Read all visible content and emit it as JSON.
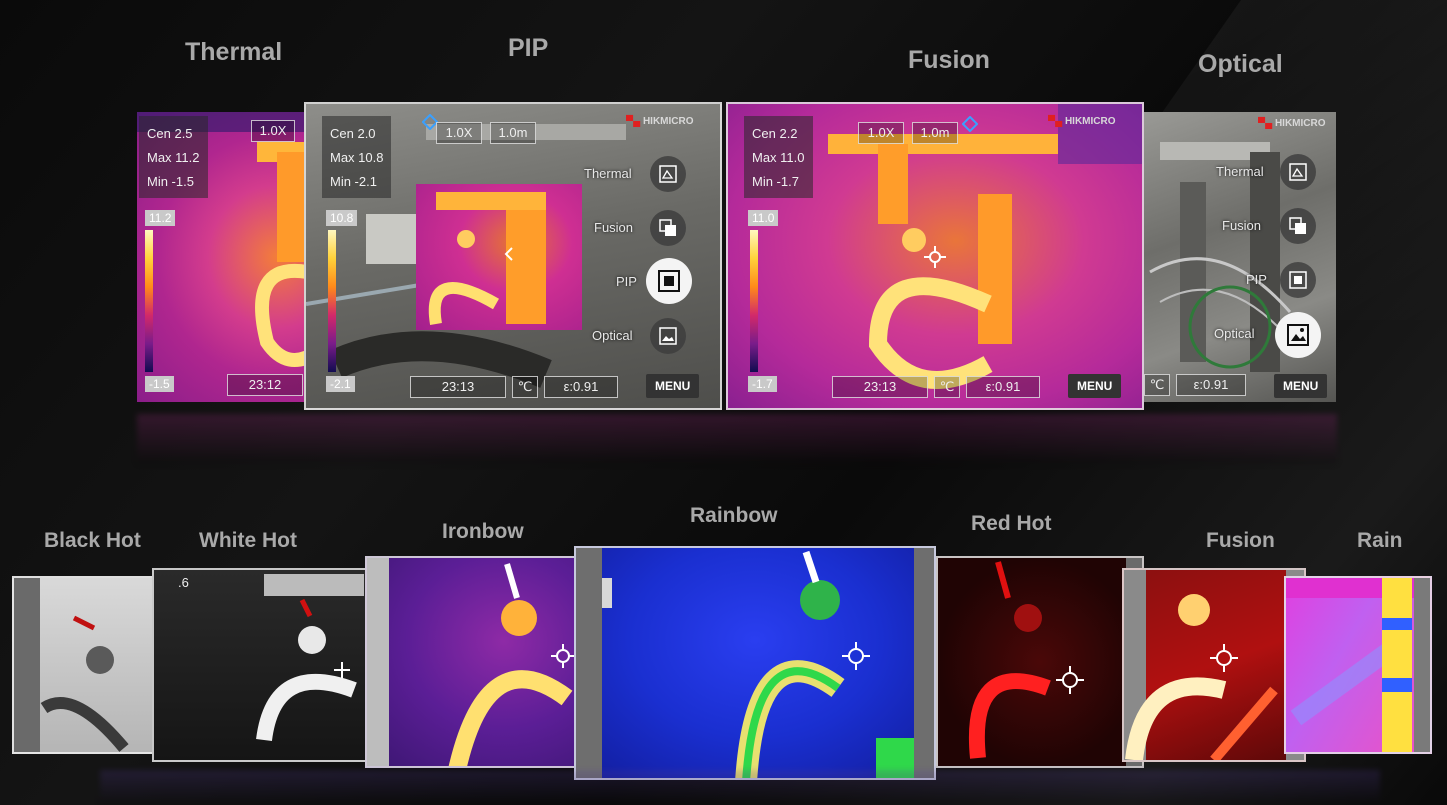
{
  "top_titles": {
    "thermal": "Thermal",
    "pip": "PIP",
    "fusion": "Fusion",
    "optical": "Optical"
  },
  "thermal": {
    "cen": "Cen 2.5",
    "max": "Max 11.2",
    "min": "Min -1.5",
    "zoom": "1.0X",
    "scale_max": "11.2",
    "scale_min": "-1.5",
    "time": "23:12"
  },
  "pip": {
    "cen": "Cen 2.0",
    "max": "Max 10.8",
    "min": "Min -2.1",
    "zoom": "1.0X",
    "distance": "1.0m",
    "scale_max": "10.8",
    "scale_min": "-2.1",
    "time": "23:13",
    "unit": "℃",
    "emissivity": "ε:0.91",
    "logo": "HIKMICRO",
    "menu": "MENU"
  },
  "fusion": {
    "cen": "Cen 2.2",
    "max": "Max 11.0",
    "min": "Min -1.7",
    "zoom": "1.0X",
    "distance": "1.0m",
    "scale_max": "11.0",
    "scale_min": "-1.7",
    "time": "23:13",
    "unit": "℃",
    "emissivity": "ε:0.91",
    "logo": "HIKMICRO",
    "menu": "MENU"
  },
  "optical": {
    "logo": "HIKMICRO",
    "unit": "℃",
    "emissivity": "ε:0.91",
    "menu": "MENU"
  },
  "mode_menu": {
    "thermal": "Thermal",
    "fusion": "Fusion",
    "pip": "PIP",
    "optical": "Optical"
  },
  "palette_titles": {
    "black_hot": "Black Hot",
    "white_hot": "White Hot",
    "ironbow": "Ironbow",
    "rainbow": "Rainbow",
    "red_hot": "Red Hot",
    "fusion": "Fusion",
    "rain": "Rain"
  },
  "white_hot_tag": ".6",
  "colors": {
    "magenta": "#c2208e",
    "orange": "#ff9f1a",
    "hot_yellow": "#ffe680",
    "rainbow_blue": "#1a2fd0",
    "red_hot": "#b01010",
    "frame": "#e6e6e6"
  },
  "icons": [
    "thermal-mode-icon",
    "fusion-mode-icon",
    "pip-mode-icon",
    "optical-mode-icon",
    "crosshair-icon",
    "location-marker-icon"
  ]
}
